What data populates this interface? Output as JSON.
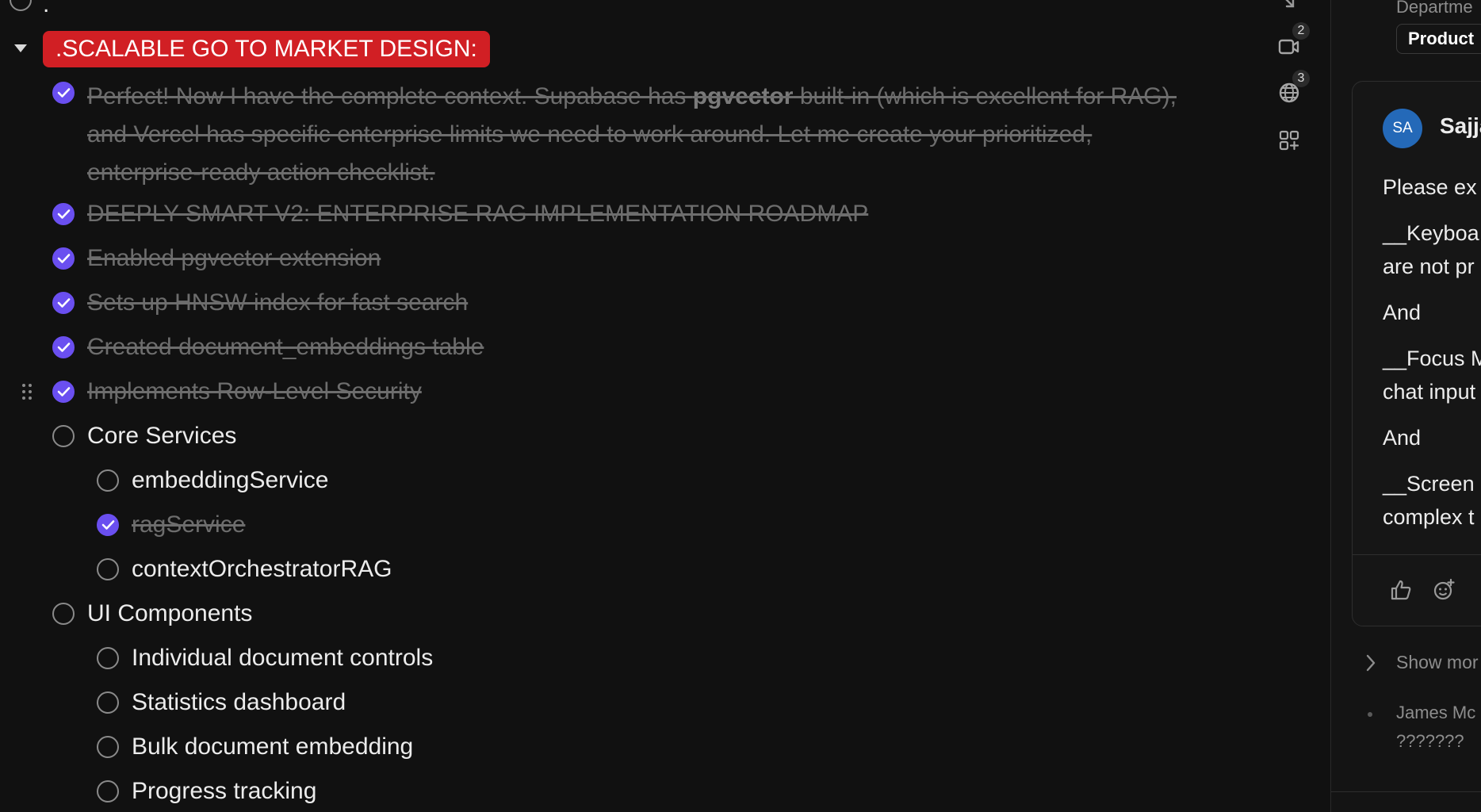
{
  "main": {
    "top_partial_text": ".",
    "heading_tag": ".SCALABLE GO TO MARKET DESIGN:",
    "completed_intro": {
      "before_bold": "Perfect! Now I have the complete context. Supabase has ",
      "bold": "pgvector",
      "after_bold": " built-in (which is excellent for RAG), and Vercel has specific enterprise limits we need to work around. Let me create your prioritized, enterprise-ready action checklist."
    },
    "tasks": [
      {
        "label": "DEEPLY SMART V2: ENTERPRISE RAG IMPLEMENTATION ROADMAP",
        "checked": true
      },
      {
        "label": "Enabled pgvector extension",
        "checked": true
      },
      {
        "label": "Sets up HNSW index for fast search",
        "checked": true
      },
      {
        "label": "Created document_embeddings table",
        "checked": true
      },
      {
        "label": "Implements Row-Level Security",
        "checked": true
      },
      {
        "label": "Core Services",
        "checked": false
      },
      {
        "label": "embeddingService",
        "checked": false
      },
      {
        "label": "ragService",
        "checked": true
      },
      {
        "label": "contextOrchestratorRAG",
        "checked": false
      },
      {
        "label": "UI Components",
        "checked": false
      },
      {
        "label": "Individual document controls",
        "checked": false
      },
      {
        "label": "Statistics dashboard",
        "checked": false
      },
      {
        "label": "Bulk document embedding",
        "checked": false
      },
      {
        "label": "Progress tracking",
        "checked": false
      }
    ]
  },
  "rail": {
    "video_badge": "2",
    "globe_badge": "3",
    "icons": [
      "collapse-icon",
      "video-icon",
      "globe-icon",
      "apps-add-icon"
    ]
  },
  "right_panel": {
    "department_label": "Departme",
    "department_value": "Product",
    "comment": {
      "avatar_initials": "SA",
      "author": "Sajja",
      "lines": [
        "Please ex",
        "__Keyboa",
        "are not pr",
        "And",
        "__Focus M",
        "chat input",
        "And",
        "__Screen",
        "complex t"
      ]
    },
    "show_more": "Show mor",
    "reply": {
      "author": "James Mc",
      "text": "???????"
    },
    "colors": {
      "avatar": "#2469b8",
      "accent": "#6a4ff0",
      "tag": "#d11f24"
    }
  }
}
